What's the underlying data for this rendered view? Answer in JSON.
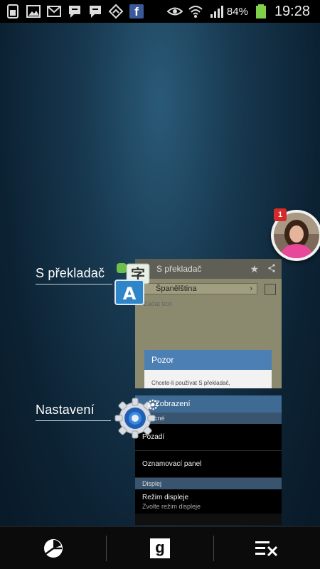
{
  "status_bar": {
    "battery_percent": "84%",
    "time": "19:28",
    "notification_icons": [
      "sim-icon",
      "image-icon",
      "gmail-icon",
      "hangouts-icon",
      "hangouts-icon",
      "feedly-icon",
      "facebook-icon"
    ],
    "facebook_glyph": "f",
    "status_icons": [
      "eye-icon",
      "wifi-icon",
      "signal-icon",
      "battery-icon"
    ]
  },
  "recent_apps": [
    {
      "label": "S překladač",
      "preview": {
        "title": "S překladač",
        "language": "Španělština",
        "placeholder": "Zadat text",
        "dialog_title": "Pozor",
        "dialog_text": "Chcete-li používat S překladač,"
      }
    },
    {
      "label": "Nastavení",
      "preview": {
        "title": "Zobrazení",
        "section_general": "Obecné",
        "item_background": "Pozadí",
        "item_notification_panel": "Oznamovací panel",
        "section_display": "Displej",
        "item_display_mode": "Režim displeje",
        "item_display_mode_sub": "Zvolte režim displeje"
      }
    }
  ],
  "chat_head": {
    "badge_count": "1"
  },
  "bottom_bar": {
    "buttons": [
      "task-manager-icon",
      "google-search-icon",
      "clear-all-icon"
    ],
    "google_glyph": "g"
  },
  "colors": {
    "background": "#0c2233",
    "dialog_header": "#4c7fb4",
    "settings_header": "#3f6a94",
    "badge": "#d62a2a"
  }
}
